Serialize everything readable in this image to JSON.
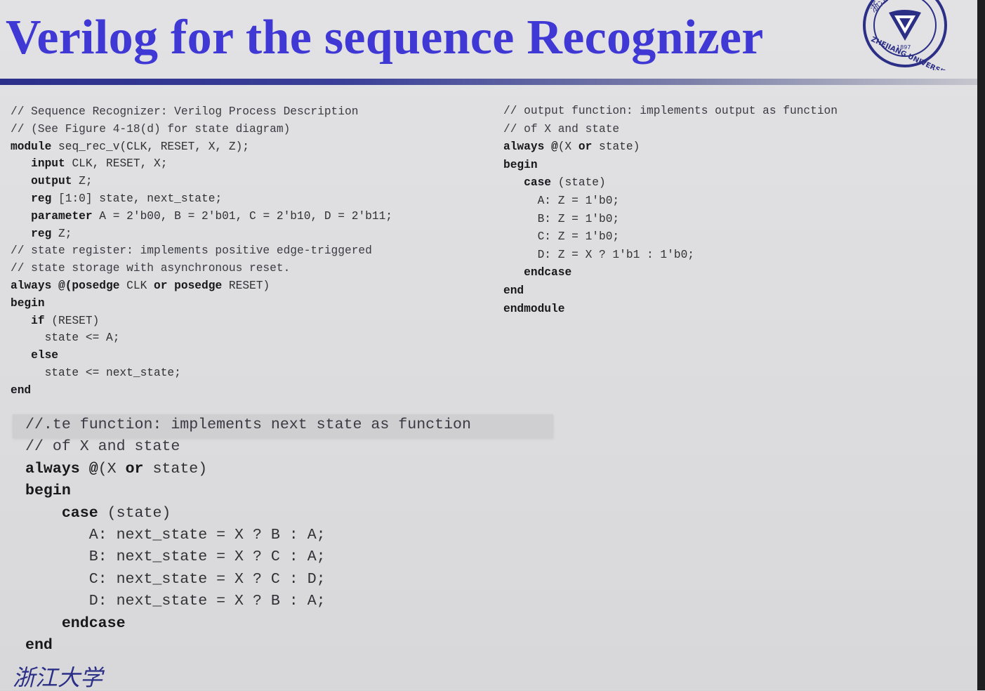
{
  "slide": {
    "title": "Verilog for the sequence Recognizer",
    "logo": {
      "name": "university-seal",
      "text_top": "浙江",
      "text_year": "1897",
      "text_bottom": "ZHEJIANG UNIVERSITY"
    },
    "footer_logo": {
      "name": "calligraphy-logo",
      "text": "浙江大学"
    }
  },
  "left_code": [
    {
      "indent": 0,
      "parts": [
        {
          "t": "// Sequence Recognizer: Verilog Process Description",
          "k": "cm"
        }
      ]
    },
    {
      "indent": 0,
      "parts": [
        {
          "t": "// (See Figure 4-18(d) for state diagram)",
          "k": "cm"
        }
      ]
    },
    {
      "indent": 0,
      "parts": [
        {
          "t": "module",
          "k": "kw"
        },
        {
          "t": " seq_rec_v(CLK, RESET, X, Z);",
          "k": ""
        }
      ]
    },
    {
      "indent": 3,
      "parts": [
        {
          "t": "input",
          "k": "kw"
        },
        {
          "t": " CLK, RESET, X;",
          "k": ""
        }
      ]
    },
    {
      "indent": 3,
      "parts": [
        {
          "t": "output",
          "k": "kw"
        },
        {
          "t": " Z;",
          "k": ""
        }
      ]
    },
    {
      "indent": 3,
      "parts": [
        {
          "t": "reg",
          "k": "kw"
        },
        {
          "t": " [1:0] state, next_state;",
          "k": ""
        }
      ]
    },
    {
      "indent": 3,
      "parts": [
        {
          "t": "parameter",
          "k": "kw"
        },
        {
          "t": " A = 2'b00, B = 2'b01, C = 2'b10, D = 2'b11;",
          "k": ""
        }
      ]
    },
    {
      "indent": 3,
      "parts": [
        {
          "t": "reg",
          "k": "kw"
        },
        {
          "t": " Z;",
          "k": ""
        }
      ]
    },
    {
      "indent": 0,
      "parts": [
        {
          "t": "// state register: implements positive edge-triggered",
          "k": "cm"
        }
      ]
    },
    {
      "indent": 0,
      "parts": [
        {
          "t": "// state storage with asynchronous reset.",
          "k": "cm"
        }
      ]
    },
    {
      "indent": 0,
      "parts": [
        {
          "t": "always @(posedge",
          "k": "kw"
        },
        {
          "t": " CLK ",
          "k": ""
        },
        {
          "t": "or posedge",
          "k": "kw"
        },
        {
          "t": " RESET)",
          "k": ""
        }
      ]
    },
    {
      "indent": 0,
      "parts": [
        {
          "t": "begin",
          "k": "kw"
        }
      ]
    },
    {
      "indent": 3,
      "parts": [
        {
          "t": "if",
          "k": "kw"
        },
        {
          "t": " (RESET)",
          "k": ""
        }
      ]
    },
    {
      "indent": 5,
      "parts": [
        {
          "t": "state <= A;",
          "k": ""
        }
      ]
    },
    {
      "indent": 3,
      "parts": [
        {
          "t": "else",
          "k": "kw"
        }
      ]
    },
    {
      "indent": 5,
      "parts": [
        {
          "t": "state <= next_state;",
          "k": ""
        }
      ]
    },
    {
      "indent": 0,
      "parts": [
        {
          "t": "end",
          "k": "kw"
        }
      ]
    }
  ],
  "right_code": [
    {
      "indent": 0,
      "parts": [
        {
          "t": "// output function: implements output as function",
          "k": "cm"
        }
      ]
    },
    {
      "indent": 0,
      "parts": [
        {
          "t": "// of X and state",
          "k": "cm"
        }
      ]
    },
    {
      "indent": 0,
      "parts": [
        {
          "t": "always @",
          "k": "kw"
        },
        {
          "t": "(X ",
          "k": ""
        },
        {
          "t": "or",
          "k": "kw"
        },
        {
          "t": " state)",
          "k": ""
        }
      ]
    },
    {
      "indent": 0,
      "parts": [
        {
          "t": "begin",
          "k": "kw"
        }
      ]
    },
    {
      "indent": 3,
      "parts": [
        {
          "t": "case",
          "k": "kw"
        },
        {
          "t": " (state)",
          "k": ""
        }
      ]
    },
    {
      "indent": 5,
      "parts": [
        {
          "t": "A: Z = 1'b0;",
          "k": ""
        }
      ]
    },
    {
      "indent": 5,
      "parts": [
        {
          "t": "B: Z = 1'b0;",
          "k": ""
        }
      ]
    },
    {
      "indent": 5,
      "parts": [
        {
          "t": "C: Z = 1'b0;",
          "k": ""
        }
      ]
    },
    {
      "indent": 5,
      "parts": [
        {
          "t": "D: Z = X ? 1'b1 : 1'b0;",
          "k": ""
        }
      ]
    },
    {
      "indent": 3,
      "parts": [
        {
          "t": "endcase",
          "k": "kw"
        }
      ]
    },
    {
      "indent": 0,
      "parts": [
        {
          "t": "end",
          "k": "kw"
        }
      ]
    },
    {
      "indent": 0,
      "parts": [
        {
          "t": "endmodule",
          "k": "kw"
        }
      ]
    }
  ],
  "bottom_code": [
    {
      "indent": 0,
      "parts": [
        {
          "t": "//.te function: implements next state as function",
          "k": "cm"
        }
      ]
    },
    {
      "indent": 0,
      "parts": [
        {
          "t": "// of X and state",
          "k": "cm"
        }
      ]
    },
    {
      "indent": 0,
      "parts": [
        {
          "t": "always @",
          "k": "kw"
        },
        {
          "t": "(X ",
          "k": ""
        },
        {
          "t": "or",
          "k": "kw"
        },
        {
          "t": " state)",
          "k": ""
        }
      ]
    },
    {
      "indent": 0,
      "parts": [
        {
          "t": "begin",
          "k": "kw"
        }
      ]
    },
    {
      "indent": 4,
      "parts": [
        {
          "t": "case",
          "k": "kw"
        },
        {
          "t": " (state)",
          "k": ""
        }
      ]
    },
    {
      "indent": 7,
      "parts": [
        {
          "t": "A: next_state = X ? B : A;",
          "k": ""
        }
      ]
    },
    {
      "indent": 7,
      "parts": [
        {
          "t": "B: next_state = X ? C : A;",
          "k": ""
        }
      ]
    },
    {
      "indent": 7,
      "parts": [
        {
          "t": "C: next_state = X ? C : D;",
          "k": ""
        }
      ]
    },
    {
      "indent": 7,
      "parts": [
        {
          "t": "D: next_state = X ? B : A;",
          "k": ""
        }
      ]
    },
    {
      "indent": 4,
      "parts": [
        {
          "t": "endcase",
          "k": "kw"
        }
      ]
    },
    {
      "indent": 0,
      "parts": [
        {
          "t": "end",
          "k": "kw"
        }
      ]
    }
  ]
}
